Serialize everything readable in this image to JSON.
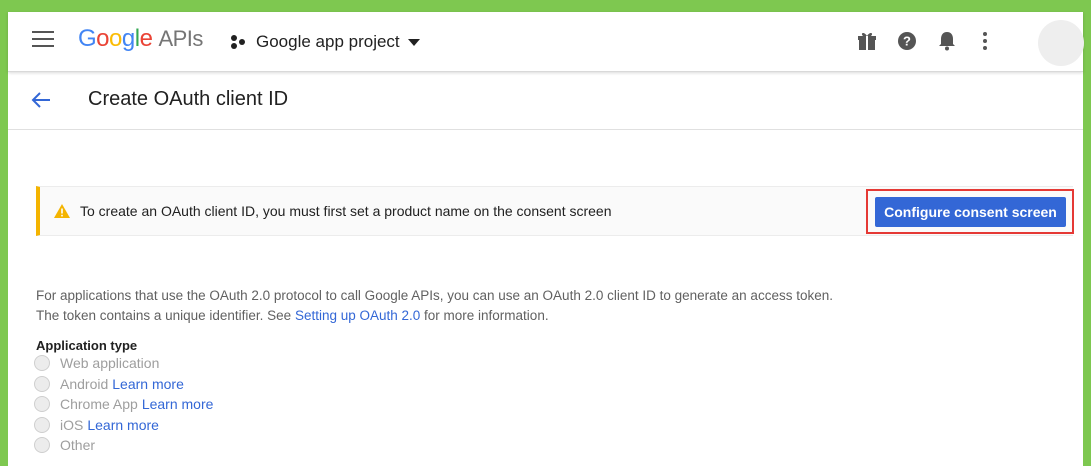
{
  "topbar": {
    "logo_google": [
      "G",
      "o",
      "o",
      "g",
      "l",
      "e"
    ],
    "logo_apis": "APIs",
    "project_name": "Google app project",
    "icons": [
      "gift-icon",
      "help-icon",
      "notifications-icon",
      "more-vert-icon"
    ]
  },
  "header": {
    "title": "Create OAuth client ID"
  },
  "warning": {
    "text": "To create an OAuth client ID, you must first set a product name on the consent screen",
    "button_label": "Configure consent screen"
  },
  "description": {
    "text_before": "For applications that use the OAuth 2.0 protocol to call Google APIs, you can use an OAuth 2.0 client ID to generate an access token. The token contains a unique identifier. See ",
    "link": "Setting up OAuth 2.0",
    "text_after": " for more information."
  },
  "application_type": {
    "label": "Application type",
    "options": [
      {
        "label": "Web application",
        "learn_more": ""
      },
      {
        "label": "Android",
        "learn_more": "Learn more"
      },
      {
        "label": "Chrome App",
        "learn_more": "Learn more"
      },
      {
        "label": "iOS",
        "learn_more": "Learn more"
      },
      {
        "label": "Other",
        "learn_more": ""
      }
    ]
  },
  "colors": {
    "frame_border": "#7ec850",
    "primary_button": "#3367d6",
    "warning_accent": "#f4b400",
    "highlight_box": "#e53935"
  }
}
